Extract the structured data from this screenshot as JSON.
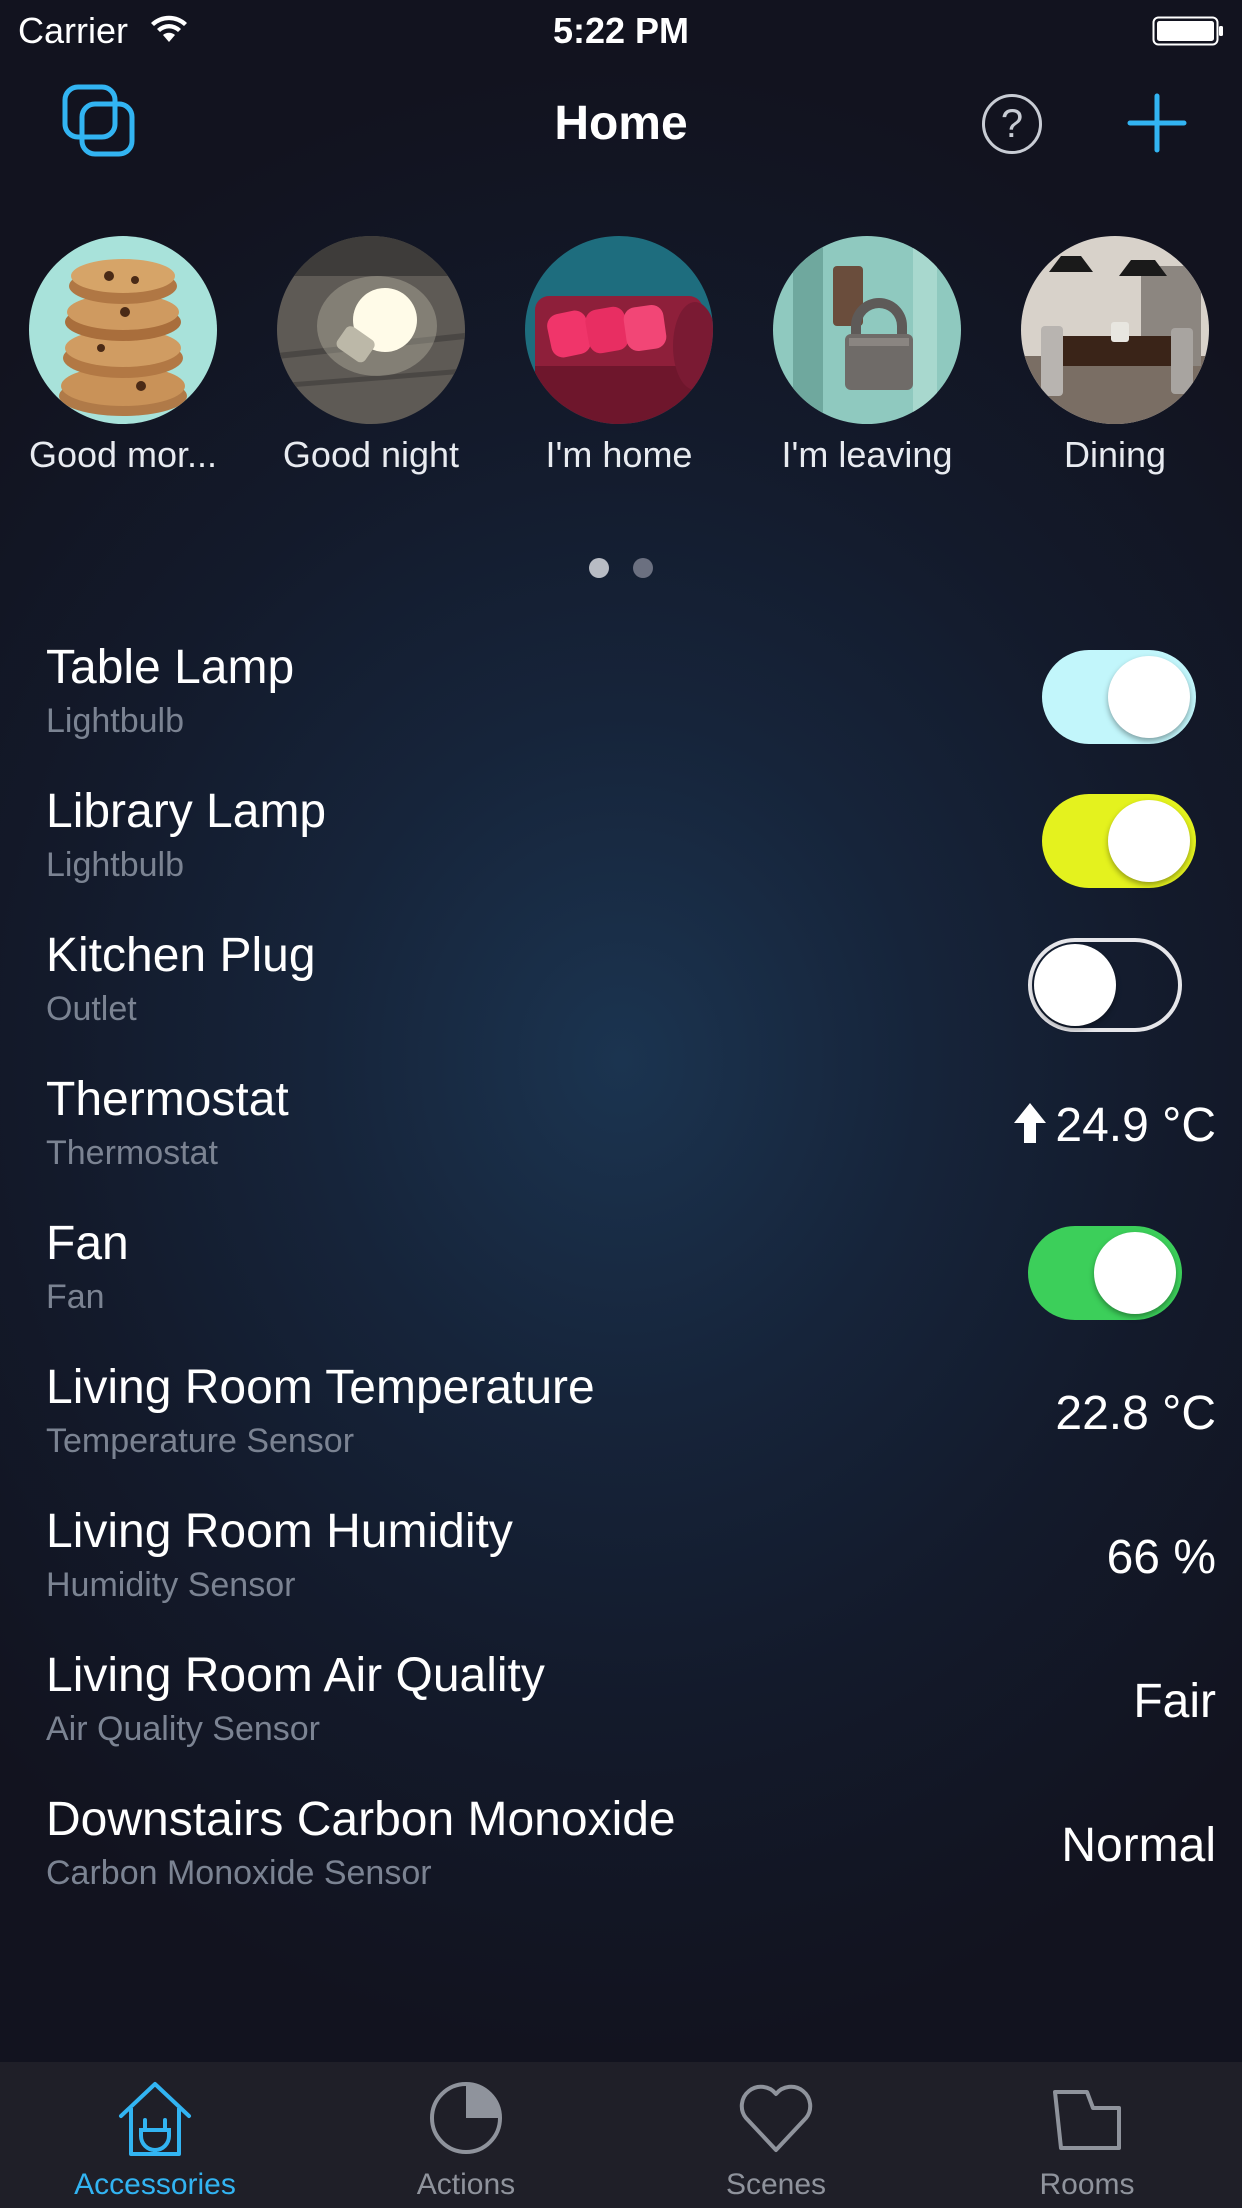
{
  "status_bar": {
    "carrier": "Carrier",
    "time": "5:22 PM"
  },
  "nav": {
    "title": "Home",
    "help_label": "?",
    "accent_color": "#32b4f2"
  },
  "scenes": [
    {
      "label": "Good mor...",
      "icon": "cookies-photo"
    },
    {
      "label": "Good night",
      "icon": "lightbulb-photo"
    },
    {
      "label": "I'm home",
      "icon": "sofa-photo"
    },
    {
      "label": "I'm leaving",
      "icon": "padlock-photo"
    },
    {
      "label": "Dining",
      "icon": "dining-room-photo"
    }
  ],
  "pager": {
    "pages": 2,
    "current": 1
  },
  "accessories": [
    {
      "name": "Table Lamp",
      "type": "Lightbulb",
      "control": "toggle",
      "on": true,
      "color": "#c2f6fb"
    },
    {
      "name": "Library Lamp",
      "type": "Lightbulb",
      "control": "toggle",
      "on": true,
      "color": "#e4f21e"
    },
    {
      "name": "Kitchen Plug",
      "type": "Outlet",
      "control": "toggle",
      "on": false
    },
    {
      "name": "Thermostat",
      "type": "Thermostat",
      "control": "value",
      "value": "24.9 °C",
      "icon": "arrow-up-icon"
    },
    {
      "name": "Fan",
      "type": "Fan",
      "control": "toggle",
      "on": true,
      "color": "#3ccf5a"
    },
    {
      "name": "Living Room Temperature",
      "type": "Temperature Sensor",
      "control": "value",
      "value": "22.8 °C"
    },
    {
      "name": "Living Room Humidity",
      "type": "Humidity Sensor",
      "control": "value",
      "value": "66 %"
    },
    {
      "name": "Living Room Air Quality",
      "type": "Air Quality Sensor",
      "control": "value",
      "value": "Fair"
    },
    {
      "name": "Downstairs Carbon Monoxide",
      "type": "Carbon Monoxide Sensor",
      "control": "value",
      "value": "Normal"
    }
  ],
  "tabs": [
    {
      "label": "Accessories",
      "icon": "house-plug-icon",
      "active": true
    },
    {
      "label": "Actions",
      "icon": "pie-clock-icon",
      "active": false
    },
    {
      "label": "Scenes",
      "icon": "heart-icon",
      "active": false
    },
    {
      "label": "Rooms",
      "icon": "room-icon",
      "active": false
    }
  ]
}
